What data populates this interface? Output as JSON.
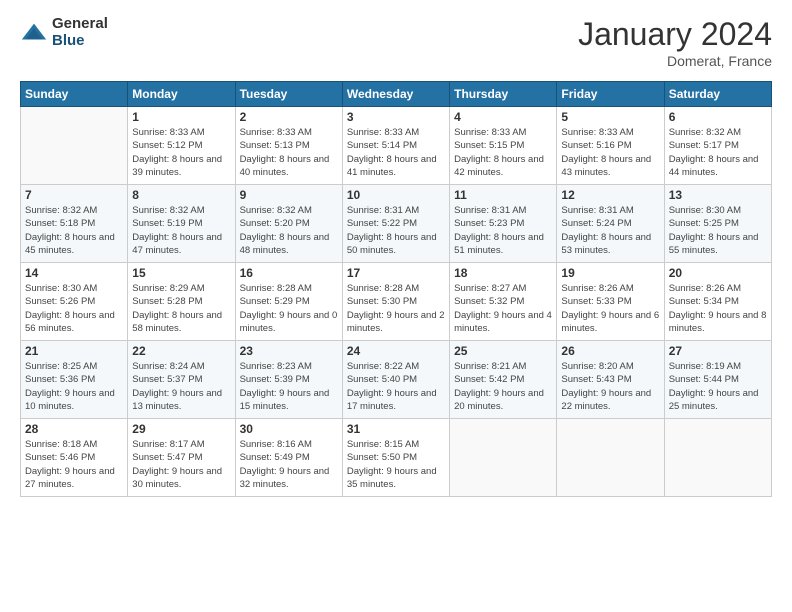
{
  "header": {
    "logo": {
      "general": "General",
      "blue": "Blue"
    },
    "title": "January 2024",
    "location": "Domerat, France"
  },
  "weekdays": [
    "Sunday",
    "Monday",
    "Tuesday",
    "Wednesday",
    "Thursday",
    "Friday",
    "Saturday"
  ],
  "weeks": [
    [
      {
        "day": "",
        "sunrise": "",
        "sunset": "",
        "daylight": ""
      },
      {
        "day": "1",
        "sunrise": "Sunrise: 8:33 AM",
        "sunset": "Sunset: 5:12 PM",
        "daylight": "Daylight: 8 hours and 39 minutes."
      },
      {
        "day": "2",
        "sunrise": "Sunrise: 8:33 AM",
        "sunset": "Sunset: 5:13 PM",
        "daylight": "Daylight: 8 hours and 40 minutes."
      },
      {
        "day": "3",
        "sunrise": "Sunrise: 8:33 AM",
        "sunset": "Sunset: 5:14 PM",
        "daylight": "Daylight: 8 hours and 41 minutes."
      },
      {
        "day": "4",
        "sunrise": "Sunrise: 8:33 AM",
        "sunset": "Sunset: 5:15 PM",
        "daylight": "Daylight: 8 hours and 42 minutes."
      },
      {
        "day": "5",
        "sunrise": "Sunrise: 8:33 AM",
        "sunset": "Sunset: 5:16 PM",
        "daylight": "Daylight: 8 hours and 43 minutes."
      },
      {
        "day": "6",
        "sunrise": "Sunrise: 8:32 AM",
        "sunset": "Sunset: 5:17 PM",
        "daylight": "Daylight: 8 hours and 44 minutes."
      }
    ],
    [
      {
        "day": "7",
        "sunrise": "Sunrise: 8:32 AM",
        "sunset": "Sunset: 5:18 PM",
        "daylight": "Daylight: 8 hours and 45 minutes."
      },
      {
        "day": "8",
        "sunrise": "Sunrise: 8:32 AM",
        "sunset": "Sunset: 5:19 PM",
        "daylight": "Daylight: 8 hours and 47 minutes."
      },
      {
        "day": "9",
        "sunrise": "Sunrise: 8:32 AM",
        "sunset": "Sunset: 5:20 PM",
        "daylight": "Daylight: 8 hours and 48 minutes."
      },
      {
        "day": "10",
        "sunrise": "Sunrise: 8:31 AM",
        "sunset": "Sunset: 5:22 PM",
        "daylight": "Daylight: 8 hours and 50 minutes."
      },
      {
        "day": "11",
        "sunrise": "Sunrise: 8:31 AM",
        "sunset": "Sunset: 5:23 PM",
        "daylight": "Daylight: 8 hours and 51 minutes."
      },
      {
        "day": "12",
        "sunrise": "Sunrise: 8:31 AM",
        "sunset": "Sunset: 5:24 PM",
        "daylight": "Daylight: 8 hours and 53 minutes."
      },
      {
        "day": "13",
        "sunrise": "Sunrise: 8:30 AM",
        "sunset": "Sunset: 5:25 PM",
        "daylight": "Daylight: 8 hours and 55 minutes."
      }
    ],
    [
      {
        "day": "14",
        "sunrise": "Sunrise: 8:30 AM",
        "sunset": "Sunset: 5:26 PM",
        "daylight": "Daylight: 8 hours and 56 minutes."
      },
      {
        "day": "15",
        "sunrise": "Sunrise: 8:29 AM",
        "sunset": "Sunset: 5:28 PM",
        "daylight": "Daylight: 8 hours and 58 minutes."
      },
      {
        "day": "16",
        "sunrise": "Sunrise: 8:28 AM",
        "sunset": "Sunset: 5:29 PM",
        "daylight": "Daylight: 9 hours and 0 minutes."
      },
      {
        "day": "17",
        "sunrise": "Sunrise: 8:28 AM",
        "sunset": "Sunset: 5:30 PM",
        "daylight": "Daylight: 9 hours and 2 minutes."
      },
      {
        "day": "18",
        "sunrise": "Sunrise: 8:27 AM",
        "sunset": "Sunset: 5:32 PM",
        "daylight": "Daylight: 9 hours and 4 minutes."
      },
      {
        "day": "19",
        "sunrise": "Sunrise: 8:26 AM",
        "sunset": "Sunset: 5:33 PM",
        "daylight": "Daylight: 9 hours and 6 minutes."
      },
      {
        "day": "20",
        "sunrise": "Sunrise: 8:26 AM",
        "sunset": "Sunset: 5:34 PM",
        "daylight": "Daylight: 9 hours and 8 minutes."
      }
    ],
    [
      {
        "day": "21",
        "sunrise": "Sunrise: 8:25 AM",
        "sunset": "Sunset: 5:36 PM",
        "daylight": "Daylight: 9 hours and 10 minutes."
      },
      {
        "day": "22",
        "sunrise": "Sunrise: 8:24 AM",
        "sunset": "Sunset: 5:37 PM",
        "daylight": "Daylight: 9 hours and 13 minutes."
      },
      {
        "day": "23",
        "sunrise": "Sunrise: 8:23 AM",
        "sunset": "Sunset: 5:39 PM",
        "daylight": "Daylight: 9 hours and 15 minutes."
      },
      {
        "day": "24",
        "sunrise": "Sunrise: 8:22 AM",
        "sunset": "Sunset: 5:40 PM",
        "daylight": "Daylight: 9 hours and 17 minutes."
      },
      {
        "day": "25",
        "sunrise": "Sunrise: 8:21 AM",
        "sunset": "Sunset: 5:42 PM",
        "daylight": "Daylight: 9 hours and 20 minutes."
      },
      {
        "day": "26",
        "sunrise": "Sunrise: 8:20 AM",
        "sunset": "Sunset: 5:43 PM",
        "daylight": "Daylight: 9 hours and 22 minutes."
      },
      {
        "day": "27",
        "sunrise": "Sunrise: 8:19 AM",
        "sunset": "Sunset: 5:44 PM",
        "daylight": "Daylight: 9 hours and 25 minutes."
      }
    ],
    [
      {
        "day": "28",
        "sunrise": "Sunrise: 8:18 AM",
        "sunset": "Sunset: 5:46 PM",
        "daylight": "Daylight: 9 hours and 27 minutes."
      },
      {
        "day": "29",
        "sunrise": "Sunrise: 8:17 AM",
        "sunset": "Sunset: 5:47 PM",
        "daylight": "Daylight: 9 hours and 30 minutes."
      },
      {
        "day": "30",
        "sunrise": "Sunrise: 8:16 AM",
        "sunset": "Sunset: 5:49 PM",
        "daylight": "Daylight: 9 hours and 32 minutes."
      },
      {
        "day": "31",
        "sunrise": "Sunrise: 8:15 AM",
        "sunset": "Sunset: 5:50 PM",
        "daylight": "Daylight: 9 hours and 35 minutes."
      },
      {
        "day": "",
        "sunrise": "",
        "sunset": "",
        "daylight": ""
      },
      {
        "day": "",
        "sunrise": "",
        "sunset": "",
        "daylight": ""
      },
      {
        "day": "",
        "sunrise": "",
        "sunset": "",
        "daylight": ""
      }
    ]
  ]
}
